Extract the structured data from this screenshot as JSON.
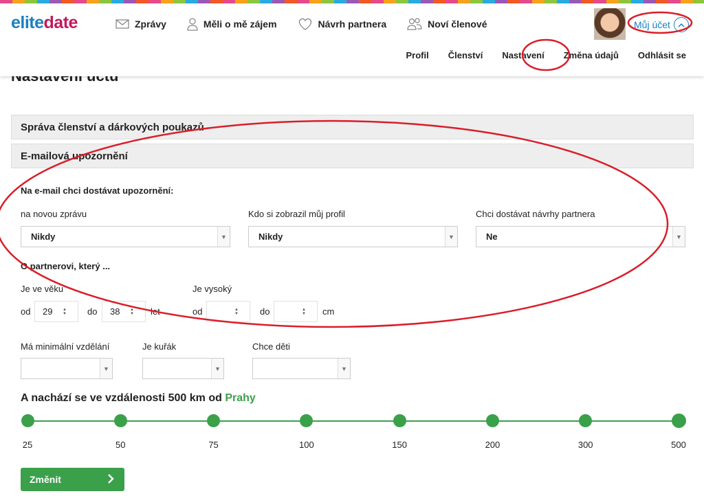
{
  "logo": {
    "part1": "elite",
    "part2": "date"
  },
  "nav": {
    "messages": "Zprávy",
    "interested": "Měli o mě zájem",
    "suggestion": "Návrh partnera",
    "new_members": "Noví členové"
  },
  "account": {
    "label": "Můj účet"
  },
  "subnav": {
    "profile": "Profil",
    "membership": "Členství",
    "settings": "Nastavení",
    "change_data": "Změna údajů",
    "logout": "Odhlásit se"
  },
  "page": {
    "title": "Nastavení účtu"
  },
  "sections": {
    "membership": "Správa členství a dárkových poukazů",
    "email_notifications": "E-mailová upozornění"
  },
  "notifications": {
    "heading": "Na e-mail chci dostávat upozornění:",
    "new_message": {
      "label": "na novou zprávu",
      "value": "Nikdy"
    },
    "profile_views": {
      "label": "Kdo si zobrazil můj profil",
      "value": "Nikdy"
    },
    "partner_suggestions": {
      "label": "Chci dostávat návrhy partnera",
      "value": "Ne"
    }
  },
  "partner": {
    "heading": "O partnerovi, který ...",
    "age": {
      "label": "Je ve věku",
      "from_label": "od",
      "from_value": "29",
      "to_label": "do",
      "to_value": "38",
      "unit": "let"
    },
    "height": {
      "label": "Je vysoký",
      "from_label": "od",
      "from_value": "",
      "to_label": "do",
      "to_value": "",
      "unit": "cm"
    },
    "education": {
      "label": "Má minimální vzdělání",
      "value": ""
    },
    "smoker": {
      "label": "Je kuřák",
      "value": ""
    },
    "children": {
      "label": "Chce děti",
      "value": ""
    }
  },
  "distance": {
    "prefix": "A nachází se ve vzdálenosti 500 km od",
    "city": "Prahy",
    "selected": "500",
    "stops": [
      "25",
      "50",
      "75",
      "100",
      "150",
      "200",
      "300",
      "500"
    ]
  },
  "submit": {
    "label": "Změnit"
  },
  "colors": {
    "accent_green": "#3aa04a",
    "brand_blue": "#1a7fc1",
    "brand_pink": "#c2185b",
    "annotation_red": "#d91e2a"
  }
}
